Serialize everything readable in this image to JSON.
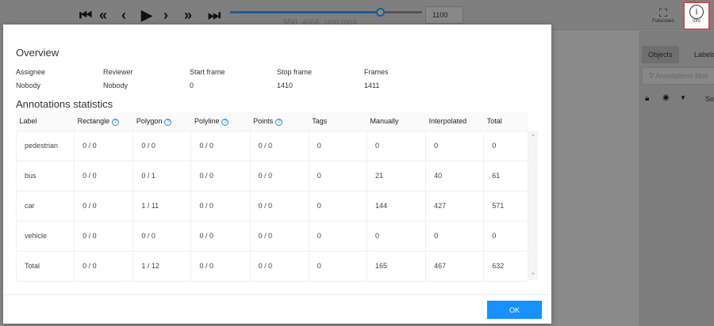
{
  "player": {
    "buttons": [
      {
        "name": "first-frame",
        "glyph": "⏮"
      },
      {
        "name": "backward-step",
        "glyph": "«"
      },
      {
        "name": "previous-frame",
        "glyph": "‹"
      },
      {
        "name": "play",
        "glyph": "▶"
      },
      {
        "name": "next-frame",
        "glyph": "›"
      },
      {
        "name": "forward-step",
        "glyph": "»"
      },
      {
        "name": "last-frame",
        "glyph": "⏭"
      }
    ],
    "frame": "1100",
    "progress_percent": 78,
    "filename": "MVI_4066_crop.mp4"
  },
  "toolbar": {
    "fullscreen": "Fullscreen",
    "info": "Info"
  },
  "sidebar": {
    "tabs": [
      "Objects",
      "Labels"
    ],
    "filter_placeholder": "Annotations filter",
    "sort": "So"
  },
  "modal": {
    "overview_title": "Overview",
    "overview": [
      {
        "label": "Assignee",
        "value": "Nobody"
      },
      {
        "label": "Reviewer",
        "value": "Nobody"
      },
      {
        "label": "Start frame",
        "value": "0"
      },
      {
        "label": "Stop frame",
        "value": "1410"
      },
      {
        "label": "Frames",
        "value": "1411"
      }
    ],
    "stats_title": "Annotations statistics",
    "columns": [
      "Label",
      "Rectangle",
      "Polygon",
      "Polyline",
      "Points",
      "Tags",
      "Manually",
      "Interpolated",
      "Total"
    ],
    "rows": [
      [
        "pedestrian",
        "0 / 0",
        "0 / 0",
        "0 / 0",
        "0 / 0",
        "0",
        "0",
        "0",
        "0"
      ],
      [
        "bus",
        "0 / 0",
        "0 / 1",
        "0 / 0",
        "0 / 0",
        "0",
        "21",
        "40",
        "61"
      ],
      [
        "car",
        "0 / 0",
        "1 / 11",
        "0 / 0",
        "0 / 0",
        "0",
        "144",
        "427",
        "571"
      ],
      [
        "vehicle",
        "0 / 0",
        "0 / 0",
        "0 / 0",
        "0 / 0",
        "0",
        "0",
        "0",
        "0"
      ],
      [
        "Total",
        "0 / 0",
        "1 / 12",
        "0 / 0",
        "0 / 0",
        "0",
        "165",
        "467",
        "632"
      ]
    ],
    "ok": "OK"
  },
  "colors": {
    "accent": "#1890ff",
    "info_highlight": "#d24a4a",
    "player": "#1c5a98"
  }
}
